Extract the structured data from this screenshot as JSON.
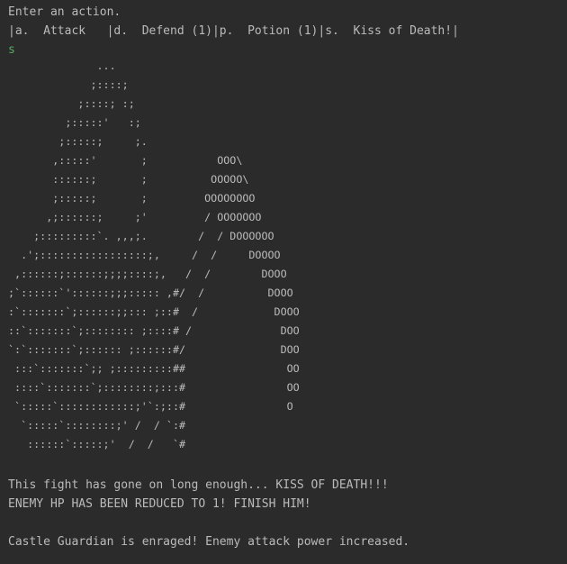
{
  "console": {
    "prompt": "Enter an action.",
    "menu": "|a.  Attack   |d.  Defend (1)|p.  Potion (1)|s.  Kiss of Death!|",
    "user_input": "s",
    "ascii_art": "              ...\n             ;::::;\n           ;::::; :;\n         ;:::::'   :;\n        ;:::::;     ;.\n       ,:::::'       ;           OOO\\\n       ::::::;       ;          OOOOO\\\n       ;:::::;       ;         OOOOOOOO\n      ,;::::::;     ;'         / OOOOOOO\n    ;:::::::::`. ,,,;.        /  / DOOOOOO\n  .';:::::::::::::::::;,     /  /     DOOOO\n ,::::::;::::::;;;;::::;,   /  /        DOOO\n;`::::::`'::::::;;;::::: ,#/  /          DOOO\n:`:::::::`;::::::;;::: ;::#  /            DOOO\n::`:::::::`;:::::::: ;::::# /              DOO\n`:`:::::::`;:::::: ;::::::#/               DOO\n :::`:::::::`;; ;:::::::::##                OO\n ::::`:::::::`;::::::::;:::#                OO\n `:::::`::::::::::::;'`:;::#                O\n  `:::::`::::::::;' /  / `:#\n   ::::::`:::::;'  /  /   `#",
    "messages": {
      "kiss": "This fight has gone on long enough... KISS OF DEATH!!!",
      "reduced": "ENEMY HP HAS BEEN REDUCED TO 1! FINISH HIM!",
      "enraged": "Castle Guardian is enraged! Enemy attack power increased."
    }
  }
}
